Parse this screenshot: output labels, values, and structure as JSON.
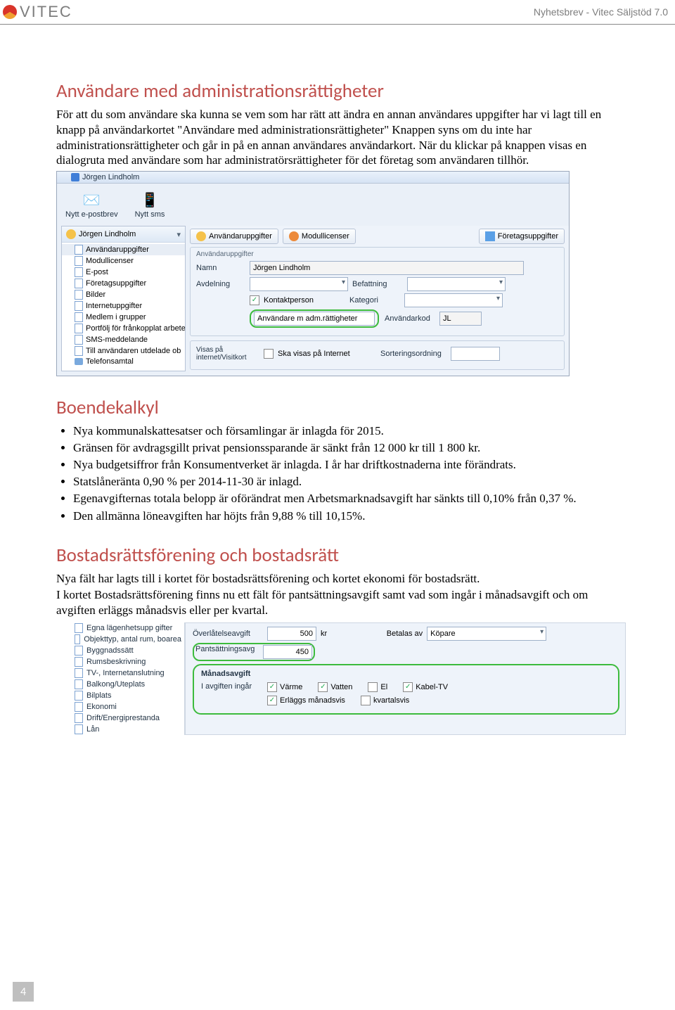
{
  "header": {
    "brand": "VITEC",
    "right": "Nyhetsbrev - Vitec Säljstöd 7.0"
  },
  "s1": {
    "title": "Användare med administrationsrättigheter",
    "para": "För att du som användare ska kunna se vem som har rätt att ändra en annan användares uppgifter har vi lagt till en knapp på användarkortet \"Användare med administrationsrättigheter\" Knappen syns om du inte har administrationsrättigheter och går in på en annan användares användarkort. När du klickar på knappen visas en dialogruta med användare som har administratörsrättigheter för det företag som användaren tillhör."
  },
  "shot1": {
    "wintitle": "Jörgen Lindholm",
    "tool_mail": "Nytt e-postbrev",
    "tool_sms": "Nytt sms",
    "nav_head": "Jörgen Lindholm",
    "nav": [
      "Användaruppgifter",
      "Modullicenser",
      "E-post",
      "Företagsuppgifter",
      "Bilder",
      "Internetuppgifter",
      "Medlem i grupper",
      "Portfölj för frånkopplat arbete",
      "SMS-meddelande",
      "Till användaren utdelade ob",
      "Telefonsamtal"
    ],
    "tabs": [
      "Användaruppgifter",
      "Modullicenser",
      "Företagsuppgifter"
    ],
    "panel_t": "Användaruppgifter",
    "lbl_name": "Namn",
    "val_name": "Jörgen Lindholm",
    "lbl_avd": "Avdelning",
    "lbl_bef": "Befattning",
    "lbl_kontakt": "Kontaktperson",
    "lbl_kat": "Kategori",
    "btn_admin": "Användare m adm.rättigheter",
    "lbl_kod": "Användarkod",
    "val_kod": "JL",
    "lbl_internet": "Visas på internet/Visitkort",
    "chk_internet": "Ska visas på Internet",
    "lbl_sort": "Sorteringsordning"
  },
  "s2": {
    "title": "Boendekalkyl",
    "items": [
      "Nya kommunalskattesatser och församlingar är inlagda för 2015.",
      "Gränsen för avdragsgillt privat pensionssparande är sänkt från 12 000 kr till 1 800 kr.",
      "Nya budgetsiffror från Konsumentverket är inlagda. I år har driftkostnaderna inte förändrats.",
      "Statslåneränta 0,90 % per 2014-11-30 är inlagd.",
      "Egenavgifternas totala belopp är oförändrat men Arbetsmarknadsavgift har sänkts till 0,10% från 0,37 %.",
      "Den allmänna löneavgiften har höjts från 9,88 % till 10,15%."
    ]
  },
  "s3": {
    "title": "Bostadsrättsförening och bostadsrätt",
    "p1": "Nya fält har lagts till i kortet för bostadsrättsförening och kortet ekonomi för bostadsrätt.",
    "p2": "I kortet Bostadsrättsförening finns nu ett fält för pantsättningsavgift samt vad som ingår i månadsavgift och om avgiften erläggs månadsvis eller per kvartal."
  },
  "shot2": {
    "nav": [
      "Egna lägenhetsupp gifter",
      "Objekttyp, antal rum, boarea",
      "Byggnadssätt",
      "Rumsbeskrivning",
      "TV-, Internetanslutning",
      "Balkong/Uteplats",
      "Bilplats",
      "Ekonomi",
      "Drift/Energiprestanda",
      "Lån"
    ],
    "lbl_over": "Överlåtelseavgift",
    "val_over": "500",
    "unit": "kr",
    "lbl_bet": "Betalas av",
    "val_bet": "Köpare",
    "lbl_pant": "Pantsättningsavg",
    "val_pant": "450",
    "fs_title": "Månadsavgift",
    "lbl_ing": "I avgiften ingår",
    "opts": [
      "Värme",
      "Vatten",
      "El",
      "Kabel-TV"
    ],
    "checked": [
      true,
      true,
      false,
      true
    ],
    "opt_m": "Erläggs månadsvis",
    "opt_k": "kvartalsvis"
  },
  "pagenum": "4"
}
